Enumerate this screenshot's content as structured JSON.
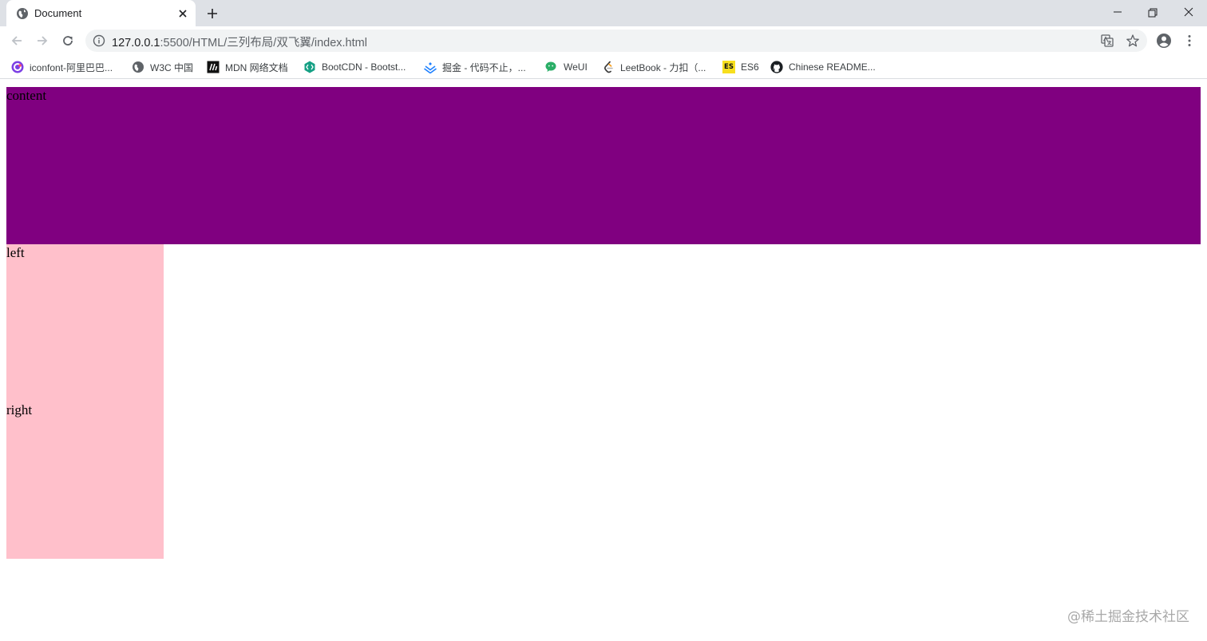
{
  "tab": {
    "title": "Document",
    "favicon": "globe-icon"
  },
  "address": {
    "host": "127.0.0.1",
    "path": ":5500/HTML/三列布局/双飞翼/index.html"
  },
  "bookmarks": [
    {
      "label": "iconfont-阿里巴巴...",
      "icon": "iconfont-icon"
    },
    {
      "label": "W3C 中国",
      "icon": "globe-icon"
    },
    {
      "label": "MDN 网络文档",
      "icon": "mdn-icon"
    },
    {
      "label": "BootCDN - Bootst...",
      "icon": "bootcdn-icon"
    },
    {
      "label": "掘金 - 代码不止，...",
      "icon": "juejin-icon"
    },
    {
      "label": "WeUI",
      "icon": "weui-icon"
    },
    {
      "label": "LeetBook - 力扣（...",
      "icon": "leetcode-icon"
    },
    {
      "label": "ES6",
      "icon": "es6-icon",
      "badge": "ES"
    },
    {
      "label": "Chinese README...",
      "icon": "github-icon"
    }
  ],
  "page": {
    "content_label": "content",
    "left_label": "left",
    "right_label": "right",
    "content_color": "#800080",
    "side_color": "#ffc0cb"
  },
  "watermark": "@稀土掘金技术社区"
}
